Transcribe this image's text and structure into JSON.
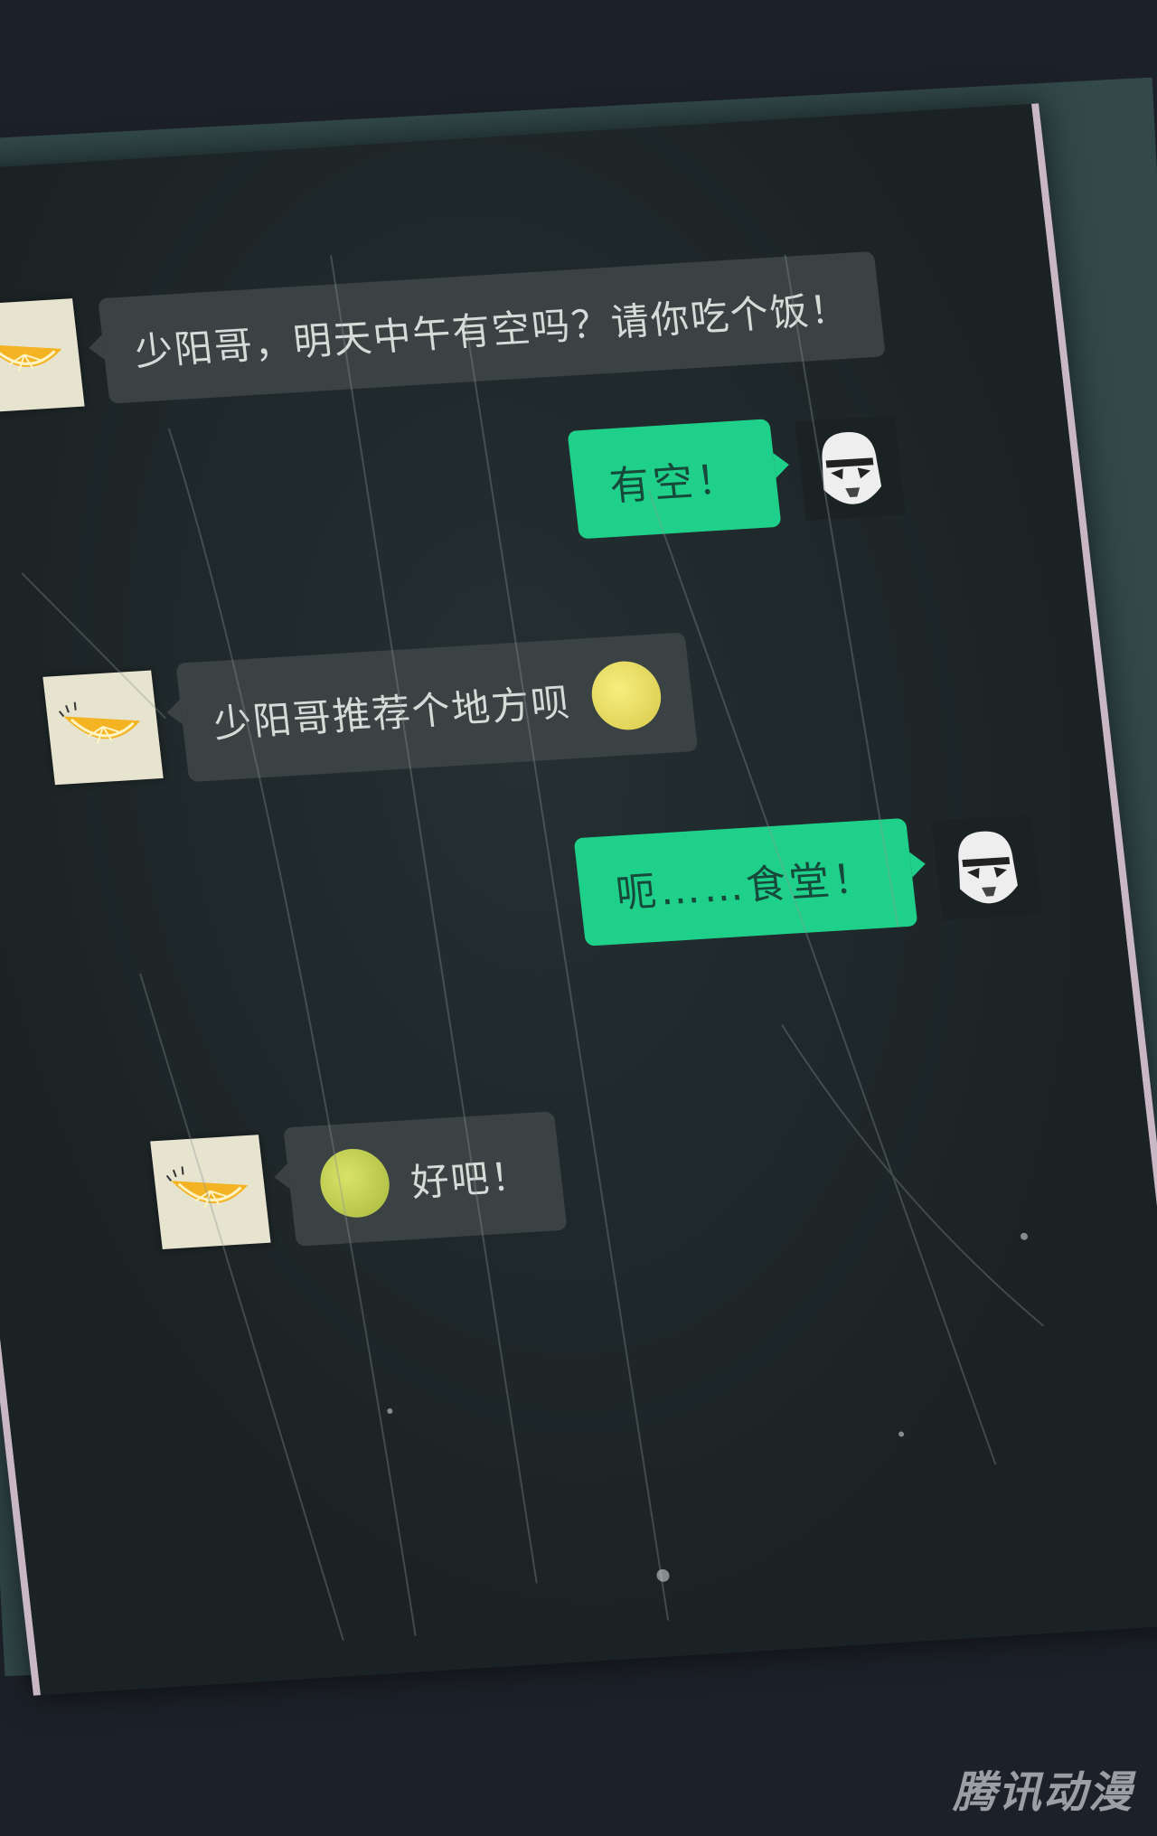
{
  "chat": {
    "title": "",
    "messages": [
      {
        "side": "in",
        "text": "少阳哥，明天中午有空吗？请你吃个饭！",
        "avatar": "orange-slice-icon"
      },
      {
        "side": "out",
        "text": "有空！",
        "avatar": "stormtrooper-helmet-icon"
      },
      {
        "side": "in",
        "text": "少阳哥推荐个地方呗",
        "avatar": "orange-slice-icon",
        "emoji": "laughing-face-icon"
      },
      {
        "side": "out",
        "text": "呃……食堂！",
        "avatar": "stormtrooper-helmet-icon"
      },
      {
        "side": "in",
        "text": "好吧！",
        "avatar": "orange-slice-icon",
        "emoji": "shocked-face-icon"
      }
    ]
  },
  "watermark": "腾讯动漫",
  "colors": {
    "outgoing_bubble": "#1fd08a",
    "incoming_bubble": "#3a4243",
    "screen_bg": "#1d2425",
    "phone_edge": "#c9b7c4"
  }
}
